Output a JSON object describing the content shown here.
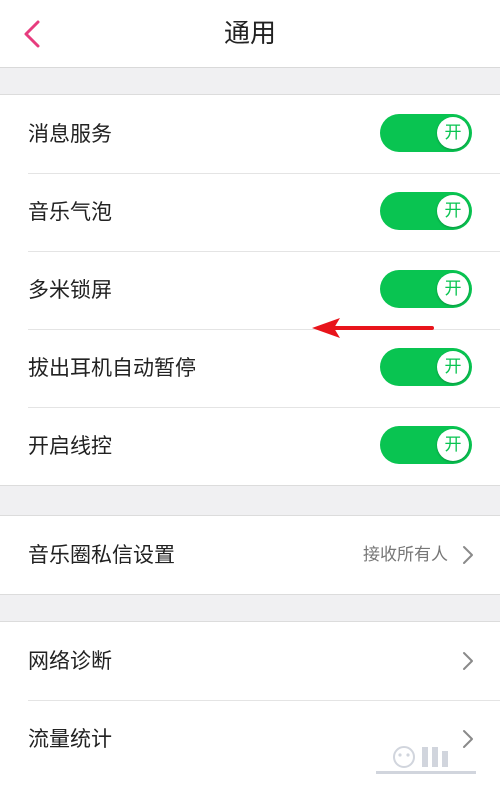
{
  "header": {
    "title": "通用",
    "back_icon": "chevron-left-icon"
  },
  "colors": {
    "accent_back": "#e73c7e",
    "toggle_on": "#09c451",
    "annotation_arrow": "#e8141b",
    "background": "#f0f0f2"
  },
  "toggles_group": {
    "items": [
      {
        "label": "消息服务",
        "state_text": "开",
        "on": true
      },
      {
        "label": "音乐气泡",
        "state_text": "开",
        "on": true
      },
      {
        "label": "多米锁屏",
        "state_text": "开",
        "on": true
      },
      {
        "label": "拔出耳机自动暂停",
        "state_text": "开",
        "on": true
      },
      {
        "label": "开启线控",
        "state_text": "开",
        "on": true
      }
    ]
  },
  "privacy_group": {
    "label": "音乐圈私信设置",
    "value": "接收所有人"
  },
  "tools_group": {
    "items": [
      {
        "label": "网络诊断"
      },
      {
        "label": "流量统计"
      }
    ]
  }
}
